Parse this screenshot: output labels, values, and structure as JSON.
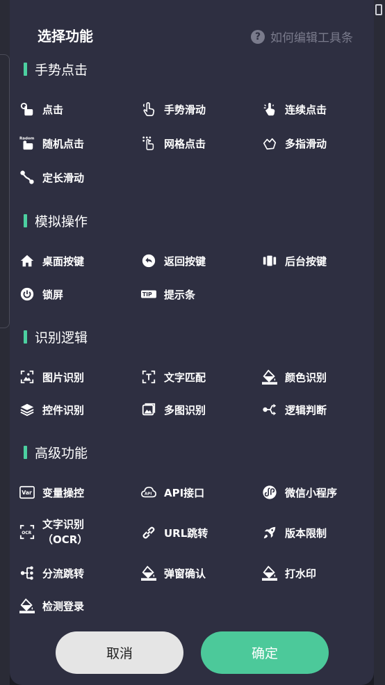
{
  "dialog": {
    "title": "选择功能",
    "help_text": "如何编辑工具条",
    "help_icon": "?"
  },
  "sections": {
    "gesture": "手势点击",
    "simulate": "模拟操作",
    "recognize": "识别逻辑",
    "advanced": "高级功能"
  },
  "items": {
    "click": "点击",
    "gesture_swipe": "手势滑动",
    "continuous_click": "连续点击",
    "random_click": "随机点击",
    "random_badge": "Radom",
    "grid_click": "网格点击",
    "multi_finger_swipe": "多指滑动",
    "fixed_swipe": "定长滑动",
    "home_key": "桌面按键",
    "back_key": "返回按键",
    "recent_key": "后台按键",
    "lock_screen": "锁屏",
    "tip_bar": "提示条",
    "tip_badge": "TIP",
    "image_recognize": "图片识别",
    "text_match": "文字匹配",
    "color_recognize": "颜色识别",
    "widget_recognize": "控件识别",
    "multi_image_recognize": "多图识别",
    "logic_judge": "逻辑判断",
    "variable_op": "变量操控",
    "var_badge": "Var",
    "api": "API接口",
    "api_badge": "API",
    "wechat_mini": "微信小程序",
    "ocr_line1": "文字识别",
    "ocr_line2": "（OCR）",
    "ocr_badge": "OCR",
    "url_jump": "URL跳转",
    "version_limit": "版本限制",
    "branch_jump": "分流跳转",
    "popup_confirm": "弹窗确认",
    "watermark": "打水印",
    "login_detect": "检测登录"
  },
  "buttons": {
    "cancel": "取消",
    "confirm": "确定"
  },
  "colors": {
    "accent": "#4cd0a0",
    "dialog_bg": "#2e2f41",
    "confirm_bg": "#4cc99a",
    "cancel_bg": "#e5e5e5"
  }
}
